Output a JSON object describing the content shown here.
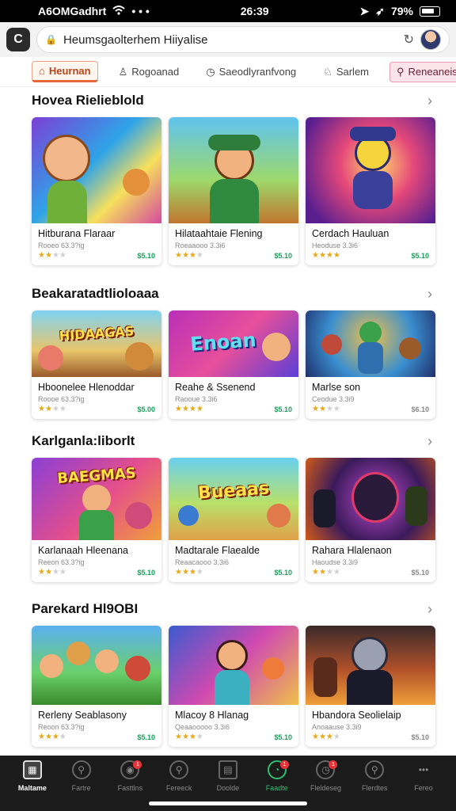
{
  "status_bar": {
    "carrier": "A6OMGadhrt",
    "time": "26:39",
    "battery": "79%",
    "signal_icon": "signal-icon",
    "wifi_icon": "wifi-icon"
  },
  "browser": {
    "url": "Heumsgaolterhem Hiiyalise"
  },
  "tabs": [
    {
      "label": "Heurnan",
      "icon": "home-icon"
    },
    {
      "label": "Rogoanad",
      "icon": "user-icon"
    },
    {
      "label": "Saeodlyranfvong",
      "icon": "clock-icon"
    },
    {
      "label": "Sarlem",
      "icon": "person-icon"
    },
    {
      "label": "Reneaneis",
      "icon": "lock-icon"
    }
  ],
  "sections": [
    {
      "title": "Hovea Rielieblold",
      "cards": [
        {
          "title": "Hitburana Flaraar",
          "sub": "Rooeo 63.3?ig",
          "rating": 2,
          "price": "$5.10",
          "banner": ""
        },
        {
          "title": "Hilataahtaie Flening",
          "sub": "Roeaaooo 3.3i6",
          "rating": 3,
          "price": "$5.10",
          "banner": ""
        },
        {
          "title": "Cerdach Hauluan",
          "sub": "Heoduse 3.3i6",
          "rating": 4,
          "price": "$5.10",
          "banner": ""
        }
      ]
    },
    {
      "title": "Beakaratadtlioloaaa",
      "cards": [
        {
          "title": "Hboonelee Hlenoddar",
          "sub": "Roooe 63.3?ig",
          "rating": 2,
          "price": "$5.00",
          "banner": "HIDAAGAS"
        },
        {
          "title": "Reahe & Ssenend",
          "sub": "Raooue 3.3i6",
          "rating": 4,
          "price": "$5.10",
          "banner": "Enoan"
        },
        {
          "title": "Marlse son",
          "sub": "Ceodue 3.3i9",
          "rating": 2,
          "price": "$6.10",
          "banner": ""
        }
      ]
    },
    {
      "title": "Karlganla:liborlt",
      "cards": [
        {
          "title": "Karlanaah Hleenana",
          "sub": "Reeon 63.3?ig",
          "rating": 2,
          "price": "$5.10",
          "banner": "BAEGMAS"
        },
        {
          "title": "Madtarale Flaealde",
          "sub": "Reaacaooo 3.3i6",
          "rating": 3,
          "price": "$5.10",
          "banner": "Bueaas"
        },
        {
          "title": "Rahara Hlalenaon",
          "sub": "Haoudse 3.3i9",
          "rating": 2,
          "price": "$5.10",
          "banner": ""
        }
      ]
    },
    {
      "title": "Parekard Hl9OBI",
      "cards": [
        {
          "title": "Rerleny Seablasony",
          "sub": "Reoon 63.3?ig",
          "rating": 3,
          "price": "$5.10",
          "banner": ""
        },
        {
          "title": "Mlacoy 8 Hlanag",
          "sub": "Qeaaooooo 3.3i6",
          "rating": 3,
          "price": "$5.10",
          "banner": ""
        },
        {
          "title": "Hbandora Seolielaip",
          "sub": "Anoaause 3.3i9",
          "rating": 3,
          "price": "$5.10",
          "banner": ""
        }
      ]
    }
  ],
  "bottom_nav": [
    {
      "label": "Maltame",
      "icon": "store-icon",
      "active": true
    },
    {
      "label": "Fartre",
      "icon": "search-icon"
    },
    {
      "label": "Fasttlns",
      "icon": "gamepad-icon",
      "badge": "1"
    },
    {
      "label": "Fereeck",
      "icon": "search-icon"
    },
    {
      "label": "Doolde",
      "icon": "grid-icon"
    },
    {
      "label": "Faadte",
      "icon": "controller-icon",
      "badge": "1",
      "green": true
    },
    {
      "label": "Fleldeseg",
      "icon": "clock-icon",
      "badge": "1"
    },
    {
      "label": "Flerdtes",
      "icon": "search-icon"
    },
    {
      "label": "Fereo",
      "icon": "more-icon"
    }
  ]
}
